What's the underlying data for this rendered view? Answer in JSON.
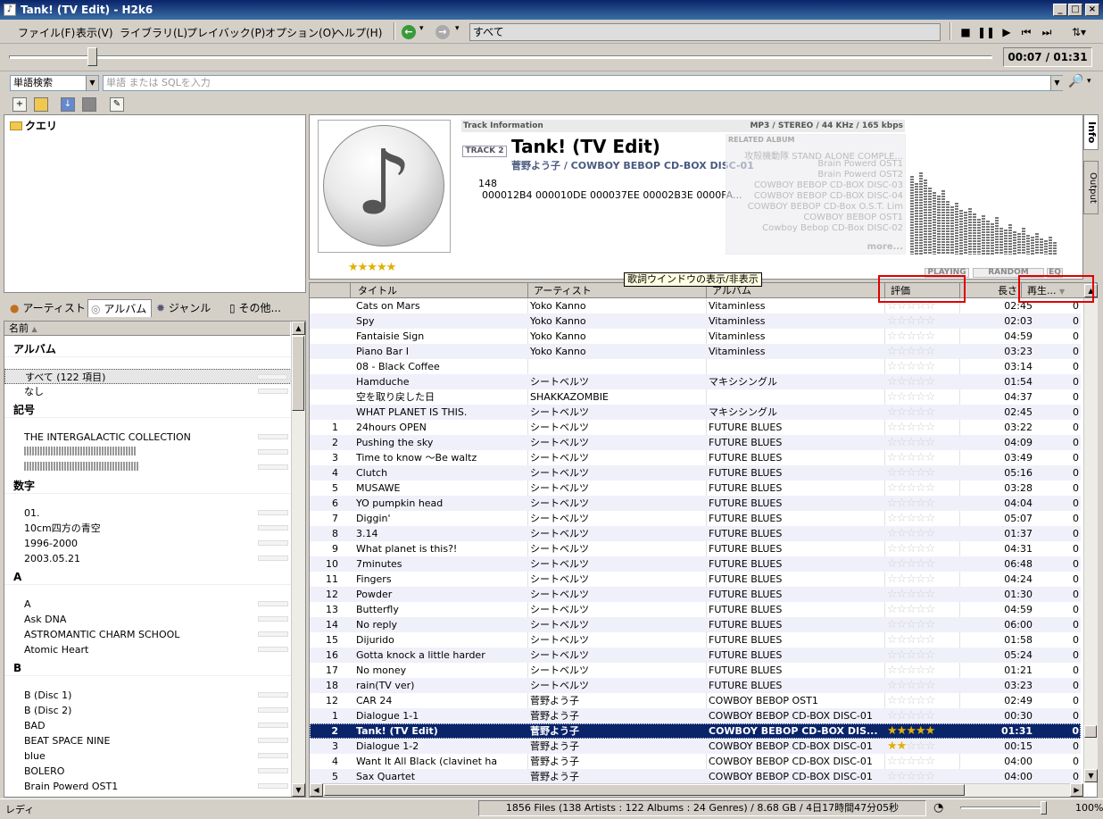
{
  "window": {
    "title": "Tank! (TV Edit) - H2k6"
  },
  "menu": [
    "ファイル(F)",
    "表示(V)",
    "ライブラリ(L)",
    "プレイバック(P)",
    "オプション(O)",
    "ヘルプ(H)"
  ],
  "filter": {
    "value": "すべて"
  },
  "player": {
    "time": "00:07 / 01:31",
    "progress": 0.08
  },
  "search": {
    "mode": "単語検索",
    "placeholder": "単語 または SQLを入力"
  },
  "query_tree": {
    "root": "クエリ"
  },
  "left_tabs": [
    "アーティスト",
    "アルバム",
    "ジャンル",
    "その他..."
  ],
  "left_list": {
    "header": "名前",
    "rows": [
      {
        "type": "group",
        "label": "アルバム"
      },
      {
        "type": "item",
        "label": "すべて (122 項目)",
        "selected": true
      },
      {
        "type": "item",
        "label": "なし"
      },
      {
        "type": "group",
        "label": "記号"
      },
      {
        "type": "item",
        "label": " THE INTERGALACTIC COLLECTION"
      },
      {
        "type": "blur"
      },
      {
        "type": "blur"
      },
      {
        "type": "group",
        "label": "数字"
      },
      {
        "type": "item",
        "label": "01."
      },
      {
        "type": "item",
        "label": "10cm四方の青空"
      },
      {
        "type": "item",
        "label": "1996-2000"
      },
      {
        "type": "item",
        "label": "2003.05.21"
      },
      {
        "type": "group",
        "label": "A"
      },
      {
        "type": "item",
        "label": "A"
      },
      {
        "type": "item",
        "label": "Ask DNA"
      },
      {
        "type": "item",
        "label": "ASTROMANTIC CHARM SCHOOL"
      },
      {
        "type": "item",
        "label": "Atomic Heart"
      },
      {
        "type": "group",
        "label": "B"
      },
      {
        "type": "item",
        "label": "B (Disc 1)"
      },
      {
        "type": "item",
        "label": "B (Disc 2)"
      },
      {
        "type": "item",
        "label": "BAD"
      },
      {
        "type": "item",
        "label": "BEAT SPACE NINE"
      },
      {
        "type": "item",
        "label": "blue"
      },
      {
        "type": "item",
        "label": "BOLERO"
      },
      {
        "type": "item",
        "label": "Brain Powerd OST1"
      },
      {
        "type": "item",
        "label": "Brain Powerd OST2"
      }
    ]
  },
  "info": {
    "header": "Track Information",
    "format": "MP3 / STEREO / 44 KHz / 165 kbps",
    "track_label": "TRACK 2",
    "title": "Tank! (TV Edit)",
    "artist_album": "菅野よう子 / COWBOY BEBOP CD-BOX DISC-01",
    "bpm": "148",
    "hash": "000012B4 000010DE 000037EE 00002B3E 0000FA...",
    "rating": 5,
    "related_header": "RELATED ALBUM",
    "related": [
      "攻殻機動隊 STAND ALONE COMPLE...",
      "Brain Powerd OST1",
      "Brain Powerd OST2",
      "COWBOY BEBOP CD-BOX DISC-03",
      "COWBOY BEBOP CD-BOX DISC-04",
      "COWBOY BEBOP CD-Box O.S.T. Lim",
      "COWBOY BEBOP OST1",
      "Cowboy Bebop CD-Box DISC-02"
    ],
    "more": "more...",
    "tabs": [
      "Info",
      "Output"
    ],
    "modes": [
      "PLAYING",
      "RANDOM",
      "EQ"
    ]
  },
  "tooltip": "歌詞ウインドウの表示/非表示",
  "columns": [
    "タイトル",
    "アーティスト",
    "アルバム",
    "評価",
    "長さ",
    "再生..."
  ],
  "tracks": [
    {
      "num": "",
      "title": "Cats on Mars",
      "artist": "Yoko Kanno",
      "album": "Vitaminless",
      "rating": 0,
      "length": "02:45",
      "plays": "0"
    },
    {
      "num": "",
      "title": "Spy",
      "artist": "Yoko Kanno",
      "album": "Vitaminless",
      "rating": 0,
      "length": "02:03",
      "plays": "0"
    },
    {
      "num": "",
      "title": "Fantaisie Sign",
      "artist": "Yoko Kanno",
      "album": "Vitaminless",
      "rating": 0,
      "length": "04:59",
      "plays": "0"
    },
    {
      "num": "",
      "title": "Piano Bar I",
      "artist": "Yoko Kanno",
      "album": "Vitaminless",
      "rating": 0,
      "length": "03:23",
      "plays": "0"
    },
    {
      "num": "",
      "title": "08 - Black Coffee",
      "artist": "",
      "album": "",
      "rating": 0,
      "length": "03:14",
      "plays": "0"
    },
    {
      "num": "",
      "title": "Hamduche",
      "artist": "シートベルツ",
      "album": "マキシシングル",
      "rating": 0,
      "length": "01:54",
      "plays": "0"
    },
    {
      "num": "",
      "title": "空を取り戻した日",
      "artist": "SHAKKAZOMBIE",
      "album": "",
      "rating": 0,
      "length": "04:37",
      "plays": "0"
    },
    {
      "num": "",
      "title": "WHAT PLANET IS THIS.",
      "artist": "シートベルツ",
      "album": "マキシシングル",
      "rating": 0,
      "length": "02:45",
      "plays": "0"
    },
    {
      "num": "1",
      "title": "24hours OPEN",
      "artist": "シートベルツ",
      "album": "FUTURE BLUES",
      "rating": 0,
      "length": "03:22",
      "plays": "0"
    },
    {
      "num": "2",
      "title": "Pushing the sky",
      "artist": "シートベルツ",
      "album": "FUTURE BLUES",
      "rating": 0,
      "length": "04:09",
      "plays": "0"
    },
    {
      "num": "3",
      "title": "Time to know ～Be waltz",
      "artist": "シートベルツ",
      "album": "FUTURE BLUES",
      "rating": 0,
      "length": "03:49",
      "plays": "0"
    },
    {
      "num": "4",
      "title": "Clutch",
      "artist": "シートベルツ",
      "album": "FUTURE BLUES",
      "rating": 0,
      "length": "05:16",
      "plays": "0"
    },
    {
      "num": "5",
      "title": "MUSAWE",
      "artist": "シートベルツ",
      "album": "FUTURE BLUES",
      "rating": 0,
      "length": "03:28",
      "plays": "0"
    },
    {
      "num": "6",
      "title": "YO pumpkin head",
      "artist": "シートベルツ",
      "album": "FUTURE BLUES",
      "rating": 0,
      "length": "04:04",
      "plays": "0"
    },
    {
      "num": "7",
      "title": "Diggin'",
      "artist": "シートベルツ",
      "album": "FUTURE BLUES",
      "rating": 0,
      "length": "05:07",
      "plays": "0"
    },
    {
      "num": "8",
      "title": "3.14",
      "artist": "シートベルツ",
      "album": "FUTURE BLUES",
      "rating": 0,
      "length": "01:37",
      "plays": "0"
    },
    {
      "num": "9",
      "title": "What planet is this?!",
      "artist": "シートベルツ",
      "album": "FUTURE BLUES",
      "rating": 0,
      "length": "04:31",
      "plays": "0"
    },
    {
      "num": "10",
      "title": "7minutes",
      "artist": "シートベルツ",
      "album": "FUTURE BLUES",
      "rating": 0,
      "length": "06:48",
      "plays": "0"
    },
    {
      "num": "11",
      "title": "Fingers",
      "artist": "シートベルツ",
      "album": "FUTURE BLUES",
      "rating": 0,
      "length": "04:24",
      "plays": "0"
    },
    {
      "num": "12",
      "title": "Powder",
      "artist": "シートベルツ",
      "album": "FUTURE BLUES",
      "rating": 0,
      "length": "01:30",
      "plays": "0"
    },
    {
      "num": "13",
      "title": "Butterfly",
      "artist": "シートベルツ",
      "album": "FUTURE BLUES",
      "rating": 0,
      "length": "04:59",
      "plays": "0"
    },
    {
      "num": "14",
      "title": "No reply",
      "artist": "シートベルツ",
      "album": "FUTURE BLUES",
      "rating": 0,
      "length": "06:00",
      "plays": "0"
    },
    {
      "num": "15",
      "title": "Dijurido",
      "artist": "シートベルツ",
      "album": "FUTURE BLUES",
      "rating": 0,
      "length": "01:58",
      "plays": "0"
    },
    {
      "num": "16",
      "title": "Gotta knock a little harder",
      "artist": "シートベルツ",
      "album": "FUTURE BLUES",
      "rating": 0,
      "length": "05:24",
      "plays": "0"
    },
    {
      "num": "17",
      "title": "No money",
      "artist": "シートベルツ",
      "album": "FUTURE BLUES",
      "rating": 0,
      "length": "01:21",
      "plays": "0"
    },
    {
      "num": "18",
      "title": "rain(TV ver)",
      "artist": "シートベルツ",
      "album": "FUTURE BLUES",
      "rating": 0,
      "length": "03:23",
      "plays": "0"
    },
    {
      "num": "12",
      "title": "CAR 24",
      "artist": "菅野よう子",
      "album": "COWBOY BEBOP OST1",
      "rating": 0,
      "length": "02:49",
      "plays": "0"
    },
    {
      "num": "1",
      "title": "Dialogue 1-1",
      "artist": "菅野よう子",
      "album": "COWBOY BEBOP CD-BOX DISC-01",
      "rating": 0,
      "length": "00:30",
      "plays": "0"
    },
    {
      "num": "2",
      "title": "Tank! (TV Edit)",
      "artist": "菅野よう子",
      "album": "COWBOY BEBOP CD-BOX DIS...",
      "rating": 5,
      "length": "01:31",
      "plays": "0",
      "selected": true
    },
    {
      "num": "3",
      "title": "Dialogue 1-2",
      "artist": "菅野よう子",
      "album": "COWBOY BEBOP CD-BOX DISC-01",
      "rating": 2,
      "length": "00:15",
      "plays": "0"
    },
    {
      "num": "4",
      "title": "Want It All Black (clavinet ha",
      "artist": "菅野よう子",
      "album": "COWBOY BEBOP CD-BOX DISC-01",
      "rating": 0,
      "length": "04:00",
      "plays": "0"
    },
    {
      "num": "5",
      "title": "Sax Quartet",
      "artist": "菅野よう子",
      "album": "COWBOY BEBOP CD-BOX DISC-01",
      "rating": 0,
      "length": "04:00",
      "plays": "0"
    }
  ],
  "status": {
    "left": "レディ",
    "summary": "1856 Files (138 Artists : 122 Albums : 24 Genres) / 8.68 GB / 4日17時間47分05秒",
    "zoom": "100%",
    "volume": 1.0
  }
}
